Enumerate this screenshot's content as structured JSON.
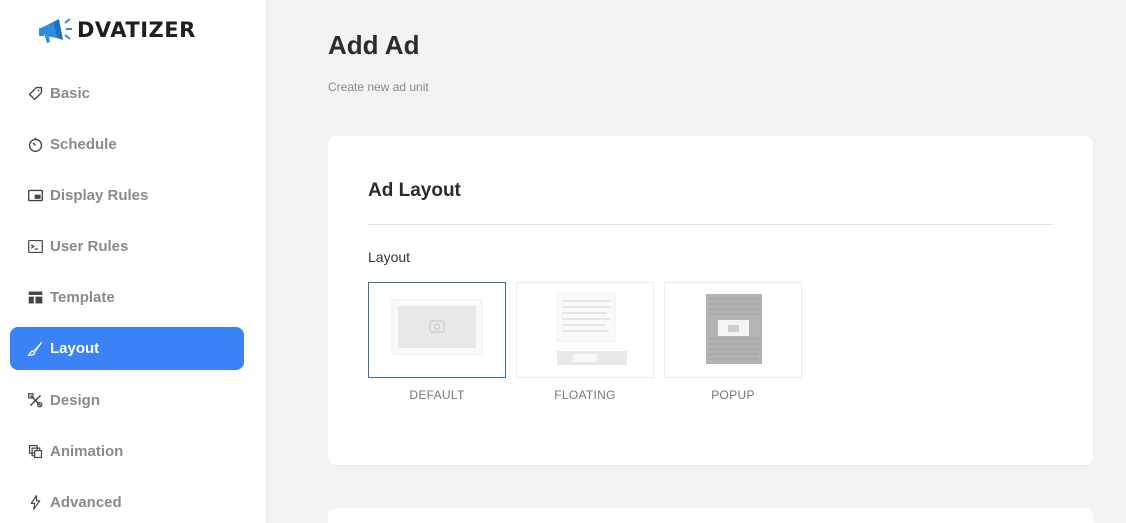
{
  "brand": {
    "name": "DVATIZER",
    "logo_icon": "megaphone-icon",
    "accent": "#3b82f6"
  },
  "sidebar": {
    "items": [
      {
        "label": "Basic",
        "icon": "tag-icon",
        "active": false
      },
      {
        "label": "Schedule",
        "icon": "timer-icon",
        "active": false
      },
      {
        "label": "Display Rules",
        "icon": "picture-in-picture-icon",
        "active": false
      },
      {
        "label": "User Rules",
        "icon": "terminal-icon",
        "active": false
      },
      {
        "label": "Template",
        "icon": "template-icon",
        "active": false
      },
      {
        "label": "Layout",
        "icon": "brush-icon",
        "active": true
      },
      {
        "label": "Design",
        "icon": "tools-icon",
        "active": false
      },
      {
        "label": "Animation",
        "icon": "layers-icon",
        "active": false
      },
      {
        "label": "Advanced",
        "icon": "bolt-icon",
        "active": false
      }
    ]
  },
  "header": {
    "title": "Add Ad",
    "subtitle": "Create new ad unit"
  },
  "card": {
    "title": "Ad Layout",
    "field_label": "Layout",
    "options": [
      {
        "label": "DEFAULT",
        "selected": true
      },
      {
        "label": "FLOATING",
        "selected": false
      },
      {
        "label": "POPUP",
        "selected": false
      }
    ],
    "selected_border": "#3b6ea8"
  }
}
